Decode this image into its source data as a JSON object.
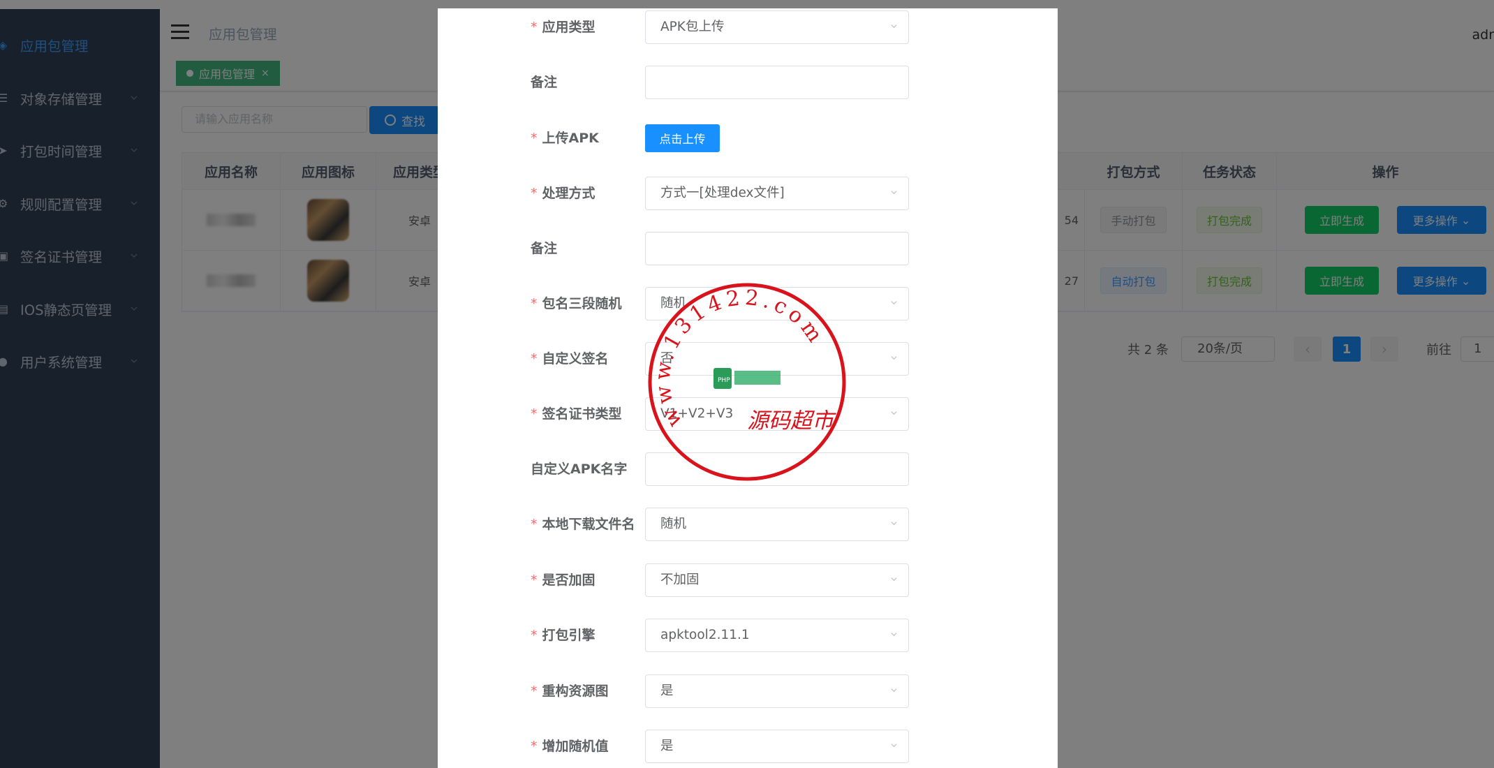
{
  "sidebar": {
    "items": [
      {
        "icon": "package-icon",
        "label": "应用包管理",
        "active": true
      },
      {
        "icon": "list-icon",
        "label": "对象存储管理"
      },
      {
        "icon": "send-icon",
        "label": "打包时间管理"
      },
      {
        "icon": "gear-icon",
        "label": "规则配置管理"
      },
      {
        "icon": "certificate-icon",
        "label": "签名证书管理"
      },
      {
        "icon": "page-icon",
        "label": "IOS静态页管理"
      },
      {
        "icon": "user-icon",
        "label": "用户系统管理"
      }
    ]
  },
  "header": {
    "breadcrumb": "应用包管理",
    "user": "adr"
  },
  "tags": [
    {
      "label": "应用包管理",
      "close": "×"
    }
  ],
  "search": {
    "placeholder": "请输入应用名称",
    "button_label": "查找"
  },
  "table": {
    "headers": {
      "name": "应用名称",
      "icon": "应用图标",
      "type": "应用类型",
      "time_suffix_col": "",
      "pack_mode": "打包方式",
      "task_status": "任务状态",
      "actions": "操作"
    },
    "rows": [
      {
        "type": "安卓",
        "time_tail": "54",
        "pack_mode": "手动打包",
        "status": "打包完成",
        "gen": "立即生成",
        "more": "更多操作"
      },
      {
        "type": "安卓",
        "time_tail": "27",
        "pack_mode": "自动打包",
        "status": "打包完成",
        "gen": "立即生成",
        "more": "更多操作"
      }
    ]
  },
  "pager": {
    "total": "共 2 条",
    "page_size": "20条/页",
    "prev": "‹",
    "current": "1",
    "next": "›",
    "goto_label": "前往",
    "goto_value": "1"
  },
  "dialog": {
    "fields": [
      {
        "label": "应用类型",
        "required": true,
        "kind": "select",
        "value": "APK包上传"
      },
      {
        "label": "备注",
        "required": false,
        "kind": "input",
        "value": ""
      },
      {
        "label": "上传APK",
        "required": true,
        "kind": "upload",
        "value": "点击上传"
      },
      {
        "label": "处理方式",
        "required": true,
        "kind": "select",
        "value": "方式一[处理dex文件]"
      },
      {
        "label": "备注",
        "required": false,
        "kind": "input",
        "value": ""
      },
      {
        "label": "包名三段随机",
        "required": true,
        "kind": "select",
        "value": "随机"
      },
      {
        "label": "自定义签名",
        "required": true,
        "kind": "select",
        "value": "否"
      },
      {
        "label": "签名证书类型",
        "required": true,
        "kind": "select",
        "value": "V1+V2+V3"
      },
      {
        "label": "自定义APK名字",
        "required": false,
        "kind": "input",
        "value": ""
      },
      {
        "label": "本地下载文件名",
        "required": true,
        "kind": "select",
        "value": "随机"
      },
      {
        "label": "是否加固",
        "required": true,
        "kind": "select",
        "value": "不加固"
      },
      {
        "label": "打包引擎",
        "required": true,
        "kind": "select",
        "value": "apktool2.11.1"
      },
      {
        "label": "重构资源图",
        "required": true,
        "kind": "select",
        "value": "是"
      },
      {
        "label": "增加随机值",
        "required": true,
        "kind": "select",
        "value": "是"
      }
    ],
    "required_mark": "*"
  },
  "watermark": {
    "ring_text": "www.131422.com",
    "center_text": "源码超市",
    "color": "#d9131b"
  },
  "colors": {
    "sidebar_bg": "#304156",
    "primary": "#1890ff",
    "success": "#13ce66",
    "tag_green": "#42b983"
  }
}
